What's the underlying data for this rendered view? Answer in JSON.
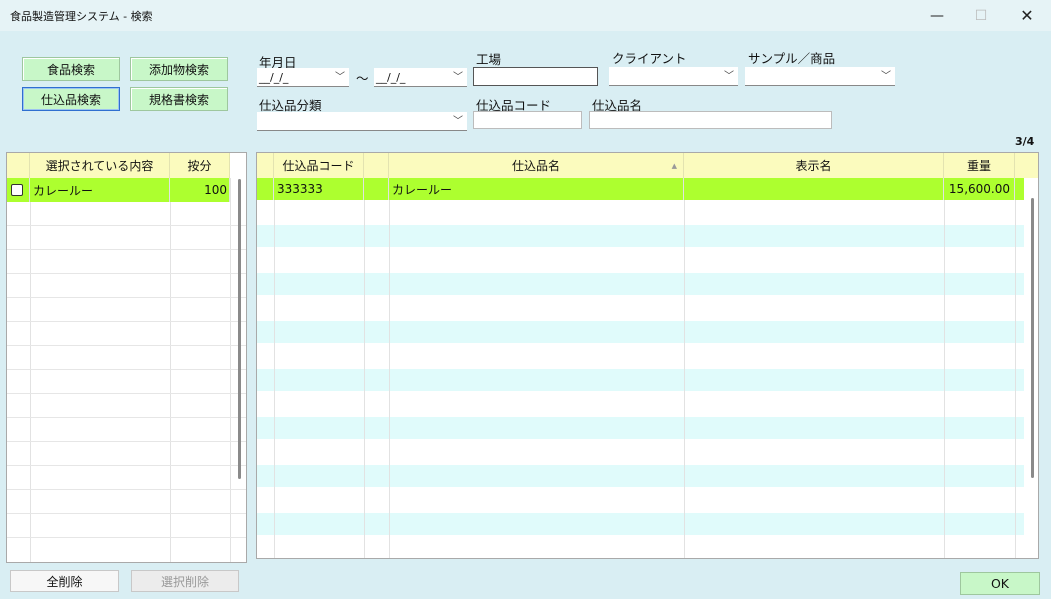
{
  "window": {
    "title": "食品製造管理システム - 検索",
    "minimize": "—",
    "maximize": "☐",
    "close": "✕"
  },
  "nav_buttons": {
    "food_search": "食品検索",
    "additive_search": "添加物検索",
    "prep_search": "仕込品検索",
    "spec_search": "規格書検索"
  },
  "filters": {
    "date_label": "年月日",
    "date_from": "__/_/_",
    "date_to": "__/_/_",
    "tilde": "～",
    "factory_label": "工場",
    "factory_value": "",
    "client_label": "クライアント",
    "client_value": "",
    "sample_label": "サンプル／商品",
    "sample_value": "",
    "category_label": "仕込品分類",
    "category_value": "",
    "code_label": "仕込品コード",
    "code_value": "",
    "name_label": "仕込品名",
    "name_value": ""
  },
  "counter": "3/4",
  "selected_grid": {
    "headers": [
      "選択されている内容",
      "按分"
    ],
    "rows": [
      {
        "checked": false,
        "content": "カレールー",
        "ratio": "100"
      }
    ]
  },
  "result_grid": {
    "headers": [
      "仕込品コード",
      "仕込品名",
      "表示名",
      "重量"
    ],
    "sort_indicator": "▲",
    "rows": [
      {
        "code": "333333",
        "name": "カレールー",
        "display_name": "",
        "weight": "15,600.00"
      }
    ]
  },
  "actions": {
    "clear_all": "全削除",
    "delete_selected": "選択削除",
    "ok": "OK"
  },
  "colors": {
    "highlight_row": "#adff2f",
    "header": "#fbfbbe",
    "alt_row": "#e0fbfb",
    "button_green": "#c8f7c8"
  }
}
